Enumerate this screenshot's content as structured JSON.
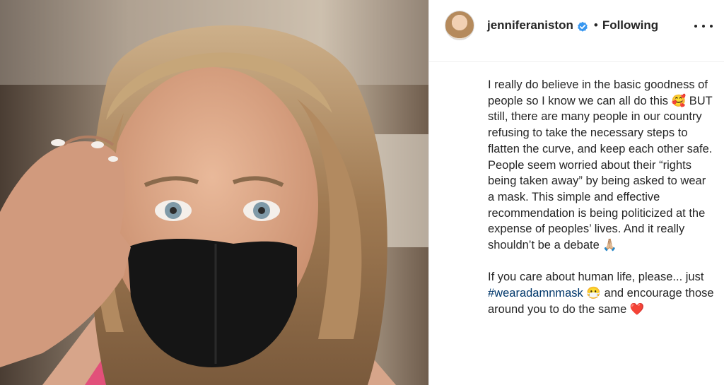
{
  "header": {
    "username": "jenniferaniston",
    "separator": "•",
    "follow_status": "Following",
    "verified_icon": "verified-badge-icon",
    "more_icon": "more-options-icon",
    "verified_color": "#3897f0"
  },
  "caption": {
    "para1": {
      "part1": "I really do believe in the basic goodness of people so I know we can all do this 🥰 BUT still, there are many people in our country refusing to take the necessary steps to flatten the curve, and keep each other safe. People seem worried about their “rights being taken away” by being asked to wear a mask. This simple and effective recommendation is being politicized at the expense of peoples’ lives. And it really shouldn’t be a debate 🙏🏼"
    },
    "para2": {
      "before": "If you care about human life, please... just ",
      "hashtag": "#wearadamnmask",
      "after": " 😷 and encourage those around you to do the same ❤️"
    }
  },
  "colors": {
    "text": "#262626",
    "hashtag": "#00376b",
    "divider": "#efefef"
  }
}
